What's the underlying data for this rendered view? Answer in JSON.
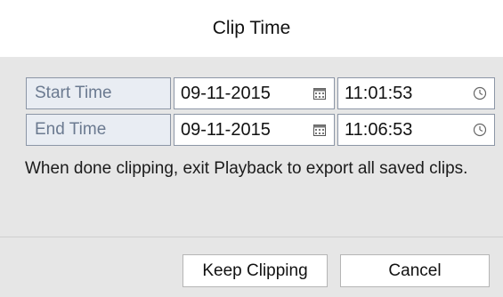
{
  "dialog": {
    "title": "Clip Time"
  },
  "times": {
    "start": {
      "label": "Start Time",
      "date": "09-11-2015",
      "time": "11:01:53"
    },
    "end": {
      "label": "End Time",
      "date": "09-11-2015",
      "time": "11:06:53"
    }
  },
  "message": "When done clipping, exit Playback to export all saved clips.",
  "buttons": {
    "keep_label": "Keep Clipping",
    "cancel_label": "Cancel"
  },
  "icons": {
    "date": "calendar-icon",
    "time": "clock-icon"
  }
}
